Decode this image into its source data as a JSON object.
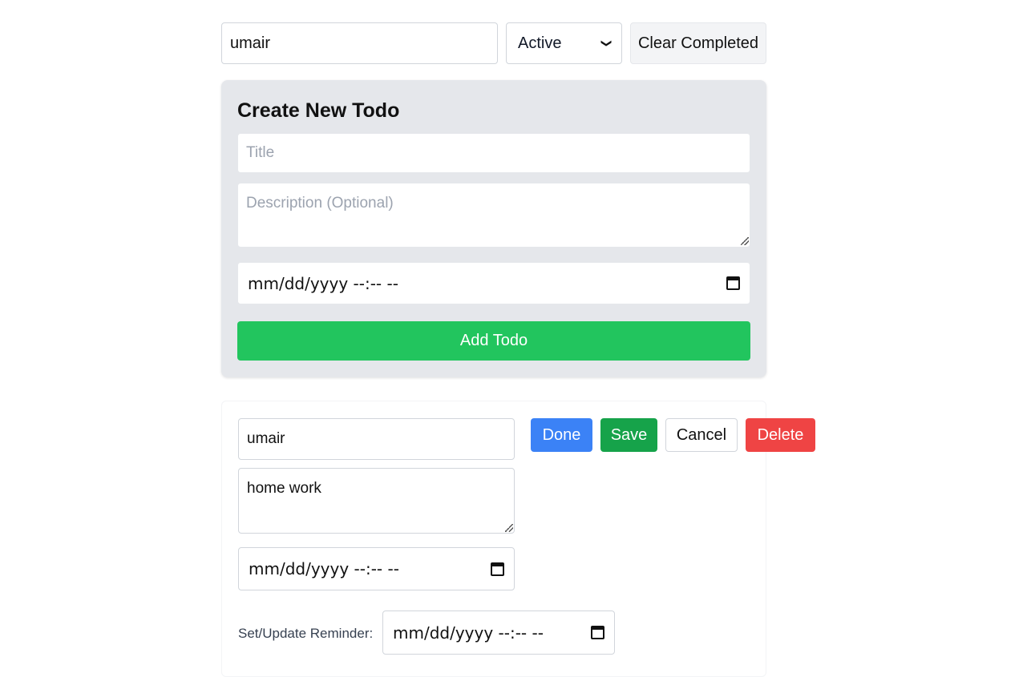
{
  "toolbar": {
    "search_value": "umair",
    "filter_selected": "Active",
    "clear_label": "Clear Completed"
  },
  "create": {
    "heading": "Create New Todo",
    "title_placeholder": "Title",
    "description_placeholder": "Description (Optional)",
    "datetime_placeholder": "mm/dd/yyyy --:-- --",
    "add_label": "Add Todo"
  },
  "todo": {
    "title_value": "umair",
    "description_value": "home work",
    "datetime_placeholder": "mm/dd/yyyy --:-- --",
    "buttons": {
      "done": "Done",
      "save": "Save",
      "cancel": "Cancel",
      "delete": "Delete"
    },
    "reminder_label": "Set/Update Reminder:",
    "reminder_placeholder": "mm/dd/yyyy --:-- --"
  },
  "colors": {
    "add": "#22c55e",
    "done": "#3b82f6",
    "save": "#16a34a",
    "delete": "#ef4444",
    "card": "#e5e7eb"
  },
  "icons": {
    "calendar": "calendar-icon",
    "chevron": "chevron-down-icon"
  }
}
